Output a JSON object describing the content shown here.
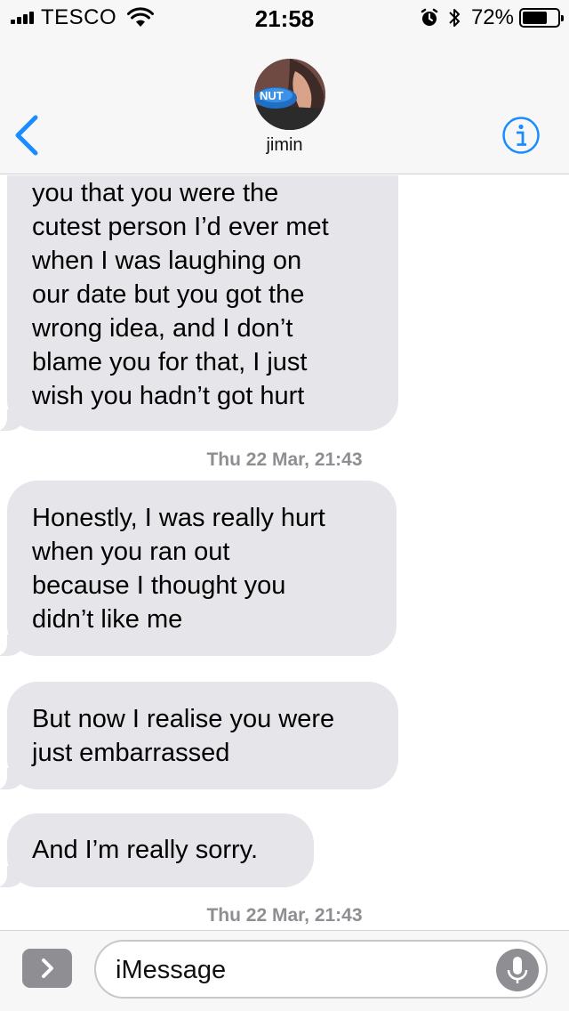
{
  "status_bar": {
    "carrier": "TESCO",
    "time": "21:58",
    "battery_percent": "72%",
    "battery_level": 0.72,
    "icons": [
      "signal-icon",
      "wifi-icon",
      "alarm-icon",
      "bluetooth-icon",
      "battery-icon"
    ]
  },
  "header": {
    "contact_name": "jimin",
    "avatar_text": "NUT",
    "back_icon": "chevron-left-icon",
    "info_icon": "info-icon",
    "accent_color": "#1a8cff"
  },
  "messages": [
    {
      "text": "you that you were the\ncutest person I’d ever met\nwhen I was laughing on\nour date but you got the\nwrong idea, and I don’t\nblame you for that, I just\nwish you hadn’t got hurt"
    },
    {
      "timestamp": "Thu 22 Mar, 21:43"
    },
    {
      "text": "Honestly, I was really hurt\nwhen you ran out\nbecause I thought you\ndidn’t like me"
    },
    {
      "text": "But now I realise you were\njust embarrassed"
    },
    {
      "text": "And I’m really sorry."
    },
    {
      "timestamp": "Thu 22 Mar, 21:43"
    }
  ],
  "input_bar": {
    "placeholder": "iMessage",
    "apps_icon": "chevron-right-icon",
    "mic_icon": "microphone-icon"
  },
  "colors": {
    "bubble_received": "#e5e5ea",
    "timestamp": "#8e8e93",
    "bar_background": "#f7f7f7"
  }
}
